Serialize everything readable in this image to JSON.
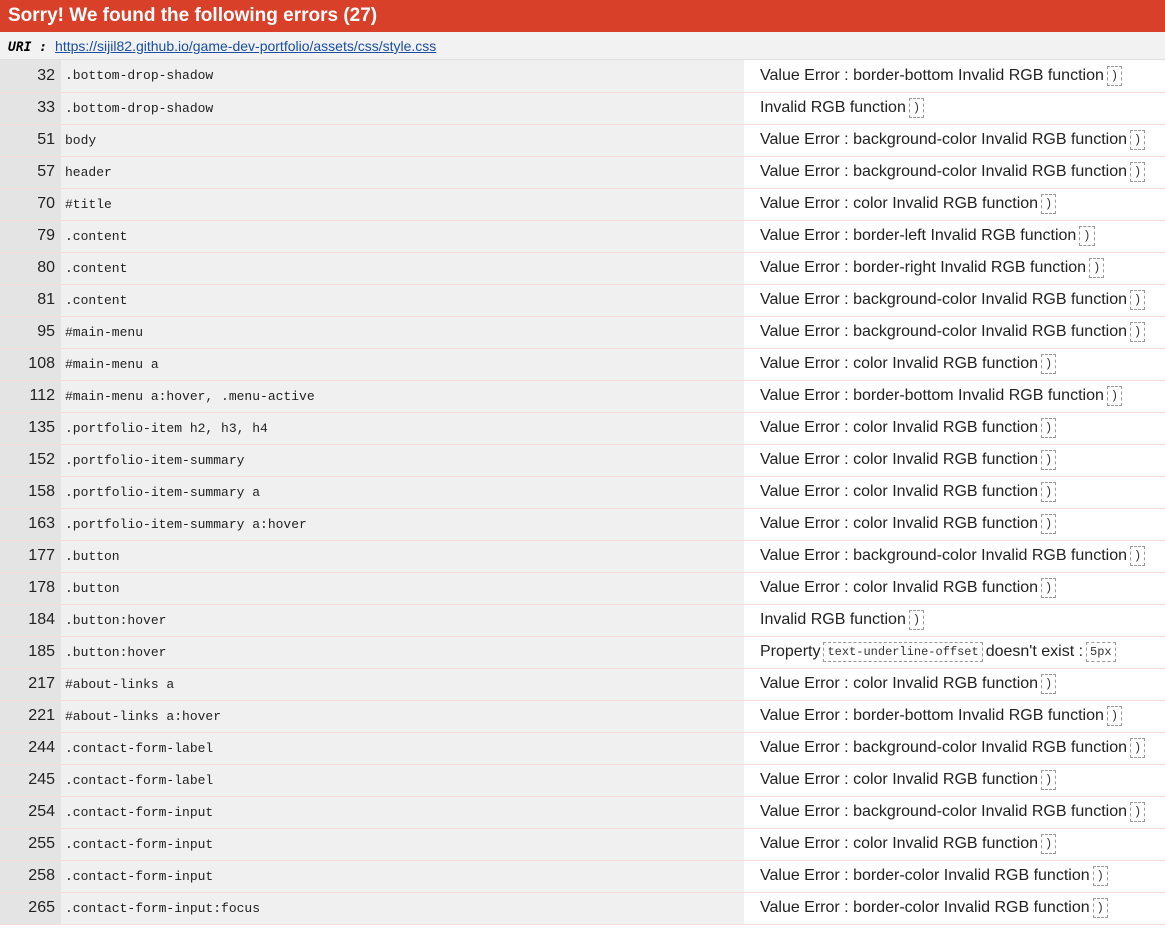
{
  "header": {
    "title": "Sorry! We found the following errors (27)"
  },
  "uri": {
    "label": "URI :",
    "link": "https://sijil82.github.io/game-dev-portfolio/assets/css/style.css"
  },
  "rows": [
    {
      "line": "32",
      "selector": ".bottom-drop-shadow",
      "message": "Value Error : border-bottom Invalid RGB function",
      "code": ")"
    },
    {
      "line": "33",
      "selector": ".bottom-drop-shadow",
      "message": "Invalid RGB function",
      "code": ")"
    },
    {
      "line": "51",
      "selector": "body",
      "message": "Value Error : background-color Invalid RGB function",
      "code": ")"
    },
    {
      "line": "57",
      "selector": "header",
      "message": "Value Error : background-color Invalid RGB function",
      "code": ")"
    },
    {
      "line": "70",
      "selector": "#title",
      "message": "Value Error : color Invalid RGB function",
      "code": ")"
    },
    {
      "line": "79",
      "selector": ".content",
      "message": "Value Error : border-left Invalid RGB function",
      "code": ")"
    },
    {
      "line": "80",
      "selector": ".content",
      "message": "Value Error : border-right Invalid RGB function",
      "code": ")"
    },
    {
      "line": "81",
      "selector": ".content",
      "message": "Value Error : background-color Invalid RGB function",
      "code": ")"
    },
    {
      "line": "95",
      "selector": "#main-menu",
      "message": "Value Error : background-color Invalid RGB function",
      "code": ")"
    },
    {
      "line": "108",
      "selector": "#main-menu a",
      "message": "Value Error : color Invalid RGB function",
      "code": ")"
    },
    {
      "line": "112",
      "selector": "#main-menu a:hover, .menu-active",
      "message": "Value Error : border-bottom Invalid RGB function",
      "code": ")"
    },
    {
      "line": "135",
      "selector": ".portfolio-item h2, h3, h4",
      "message": "Value Error : color Invalid RGB function",
      "code": ")"
    },
    {
      "line": "152",
      "selector": ".portfolio-item-summary",
      "message": "Value Error : color Invalid RGB function",
      "code": ")"
    },
    {
      "line": "158",
      "selector": ".portfolio-item-summary a",
      "message": "Value Error : color Invalid RGB function",
      "code": ")"
    },
    {
      "line": "163",
      "selector": ".portfolio-item-summary a:hover",
      "message": "Value Error : color Invalid RGB function",
      "code": ")"
    },
    {
      "line": "177",
      "selector": ".button",
      "message": "Value Error : background-color Invalid RGB function",
      "code": ")"
    },
    {
      "line": "178",
      "selector": ".button",
      "message": "Value Error : color Invalid RGB function",
      "code": ")"
    },
    {
      "line": "184",
      "selector": ".button:hover",
      "message": "Invalid RGB function",
      "code": ")"
    },
    {
      "line": "185",
      "selector": ".button:hover",
      "message_prefix": "Property",
      "code_first": "text-underline-offset",
      "message": "doesn't exist :",
      "code": "5px"
    },
    {
      "line": "217",
      "selector": "#about-links a",
      "message": "Value Error : color Invalid RGB function",
      "code": ")"
    },
    {
      "line": "221",
      "selector": "#about-links a:hover",
      "message": "Value Error : border-bottom Invalid RGB function",
      "code": ")"
    },
    {
      "line": "244",
      "selector": ".contact-form-label",
      "message": "Value Error : background-color Invalid RGB function",
      "code": ")"
    },
    {
      "line": "245",
      "selector": ".contact-form-label",
      "message": "Value Error : color Invalid RGB function",
      "code": ")"
    },
    {
      "line": "254",
      "selector": ".contact-form-input",
      "message": "Value Error : background-color Invalid RGB function",
      "code": ")"
    },
    {
      "line": "255",
      "selector": ".contact-form-input",
      "message": "Value Error : color Invalid RGB function",
      "code": ")"
    },
    {
      "line": "258",
      "selector": ".contact-form-input",
      "message": "Value Error : border-color Invalid RGB function",
      "code": ")"
    },
    {
      "line": "265",
      "selector": ".contact-form-input:focus",
      "message": "Value Error : border-color Invalid RGB function",
      "code": ")"
    }
  ]
}
